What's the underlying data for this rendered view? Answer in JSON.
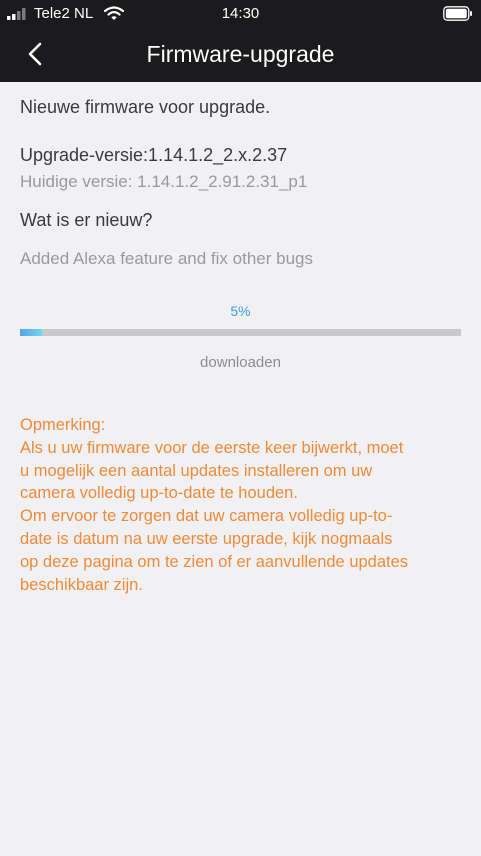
{
  "status_bar": {
    "carrier": "Tele2 NL",
    "time": "14:30"
  },
  "nav": {
    "title": "Firmware-upgrade"
  },
  "content": {
    "intro": "Nieuwe firmware voor upgrade.",
    "upgrade_version": "Upgrade-versie:1.14.1.2_2.x.2.37",
    "current_version": "Huidige versie: 1.14.1.2_2.91.2.31_p1",
    "whats_new_heading": "Wat is er nieuw?",
    "whats_new_text": "Added Alexa feature and fix other bugs",
    "progress": {
      "label": "5%",
      "value": 0.05,
      "status": "downloaden"
    },
    "note_lines": [
      "Opmerking:",
      " Als u uw firmware voor de eerste keer bijwerkt, moet",
      "u mogelijk een aantal updates installeren om uw",
      "camera volledig up-to-date te houden.",
      " Om ervoor te zorgen dat uw camera volledig up-to-",
      "date is datum na uw eerste upgrade, kijk nogmaals",
      "op deze pagina om te zien of er aanvullende updates",
      "beschikbaar zijn."
    ]
  },
  "colors": {
    "header_bg": "#1b1b1d",
    "page_bg": "#f1f1f4",
    "accent_blue": "#3aa2dc",
    "note_orange": "#f08a38"
  },
  "icons": {
    "back": "chevron-left-icon",
    "signal": "cellular-signal-icon",
    "wifi": "wifi-icon",
    "battery": "battery-icon"
  }
}
